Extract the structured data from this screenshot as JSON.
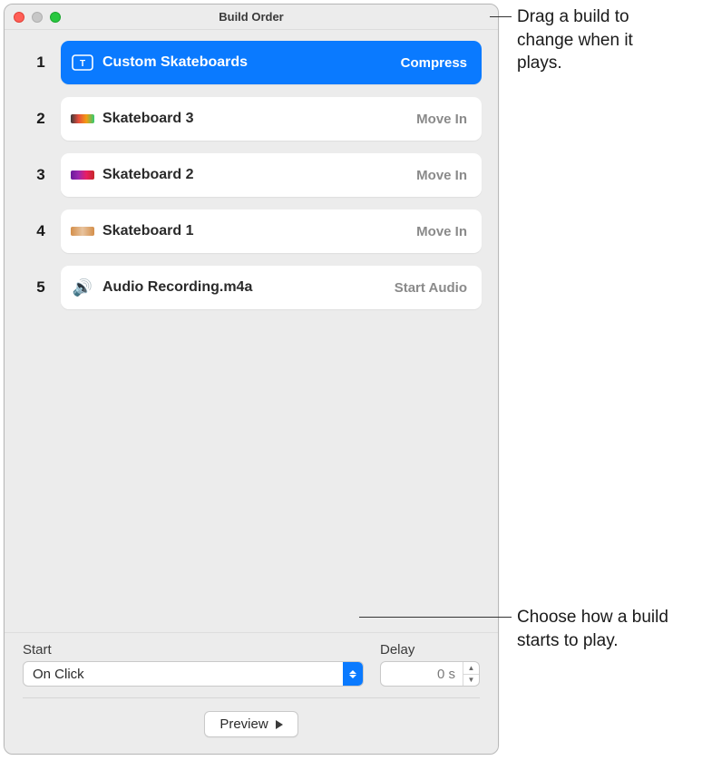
{
  "window": {
    "title": "Build Order"
  },
  "builds": [
    {
      "num": "1",
      "label": "Custom Skateboards",
      "effect": "Compress",
      "icon": "text",
      "thumb": "",
      "selected": true
    },
    {
      "num": "2",
      "label": "Skateboard 3",
      "effect": "Move In",
      "icon": "thumb",
      "thumb": "sb3",
      "selected": false
    },
    {
      "num": "3",
      "label": "Skateboard 2",
      "effect": "Move In",
      "icon": "thumb",
      "thumb": "sb2",
      "selected": false
    },
    {
      "num": "4",
      "label": "Skateboard 1",
      "effect": "Move In",
      "icon": "thumb",
      "thumb": "sb1",
      "selected": false
    },
    {
      "num": "5",
      "label": "Audio Recording.m4a",
      "effect": "Start Audio",
      "icon": "audio",
      "thumb": "",
      "selected": false
    }
  ],
  "controls": {
    "start_label": "Start",
    "start_value": "On Click",
    "delay_label": "Delay",
    "delay_value": "0 s",
    "preview_label": "Preview"
  },
  "annotations": {
    "a1": "Drag a build to change when it plays.",
    "a2": "Choose how a build starts to play."
  },
  "colors": {
    "accent": "#0a7aff"
  }
}
